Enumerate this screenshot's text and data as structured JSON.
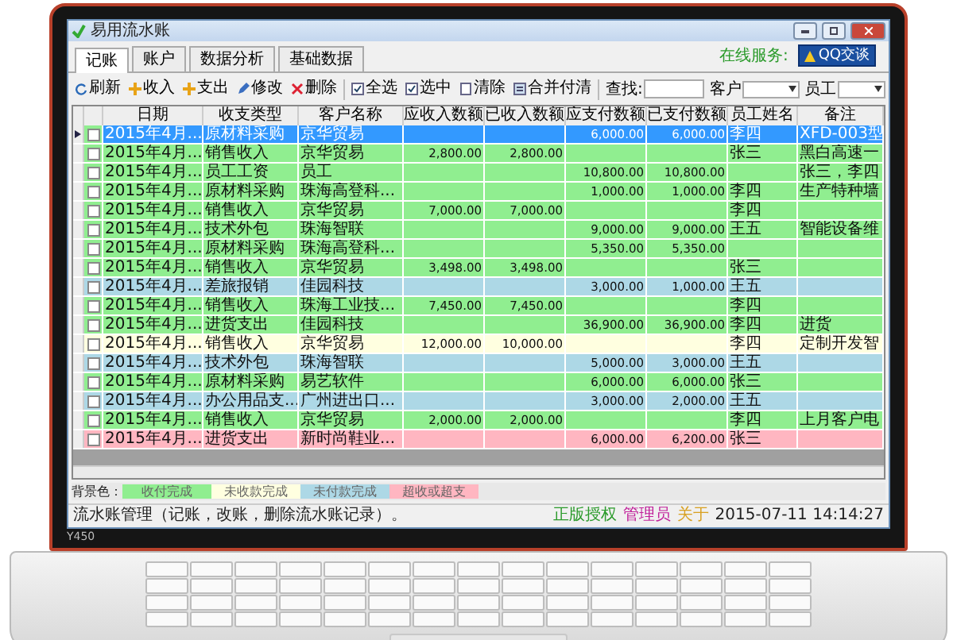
{
  "window": {
    "title": "易用流水账"
  },
  "tabs": [
    {
      "label": "记账",
      "selected": true
    },
    {
      "label": "账户",
      "selected": false
    },
    {
      "label": "数据分析",
      "selected": false
    },
    {
      "label": "基础数据",
      "selected": false
    }
  ],
  "online_service": {
    "label": "在线服务:",
    "button": "QQ交谈"
  },
  "toolbar": {
    "buttons": [
      {
        "kind": "refresh",
        "label": "刷新"
      },
      {
        "kind": "add",
        "label": "收入"
      },
      {
        "kind": "add",
        "label": "支出"
      },
      {
        "kind": "edit",
        "label": "修改"
      },
      {
        "kind": "delete",
        "label": "删除"
      },
      {
        "kind": "check",
        "label": "全选"
      },
      {
        "kind": "check",
        "label": "选中"
      },
      {
        "kind": "clear",
        "label": "清除"
      },
      {
        "kind": "merge",
        "label": "合并付清"
      }
    ],
    "search_label": "查找:",
    "customer_label": "客户",
    "employee_label": "员工"
  },
  "table": {
    "columns": [
      "日期",
      "收支类型",
      "客户名称",
      "应收入数额",
      "已收入数额",
      "应支付数额",
      "已支付数额",
      "员工姓名",
      "备注"
    ],
    "rows": [
      {
        "selected": true,
        "color": "#90ee90",
        "cells": [
          "2015年4月...",
          "原材料采购",
          "京华贸易",
          "",
          "",
          "6,000.00",
          "6,000.00",
          "李四",
          "XFD-003型"
        ]
      },
      {
        "selected": false,
        "color": "#90ee90",
        "cells": [
          "2015年4月...",
          "销售收入",
          "京华贸易",
          "2,800.00",
          "2,800.00",
          "",
          "",
          "张三",
          "黑白高速一"
        ]
      },
      {
        "selected": false,
        "color": "#90ee90",
        "cells": [
          "2015年4月...",
          "员工工资",
          "员工",
          "",
          "",
          "10,800.00",
          "10,800.00",
          "",
          "张三，李四"
        ]
      },
      {
        "selected": false,
        "color": "#90ee90",
        "cells": [
          "2015年4月...",
          "原材料采购",
          "珠海高登科...",
          "",
          "",
          "1,000.00",
          "1,000.00",
          "李四",
          "生产特种墙"
        ]
      },
      {
        "selected": false,
        "color": "#90ee90",
        "cells": [
          "2015年4月...",
          "销售收入",
          "京华贸易",
          "7,000.00",
          "7,000.00",
          "",
          "",
          "李四",
          ""
        ]
      },
      {
        "selected": false,
        "color": "#90ee90",
        "cells": [
          "2015年4月...",
          "技术外包",
          "珠海智联",
          "",
          "",
          "9,000.00",
          "9,000.00",
          "王五",
          "智能设备维"
        ]
      },
      {
        "selected": false,
        "color": "#90ee90",
        "cells": [
          "2015年4月...",
          "原材料采购",
          "珠海高登科...",
          "",
          "",
          "5,350.00",
          "5,350.00",
          "",
          ""
        ]
      },
      {
        "selected": false,
        "color": "#90ee90",
        "cells": [
          "2015年4月...",
          "销售收入",
          "京华贸易",
          "3,498.00",
          "3,498.00",
          "",
          "",
          "张三",
          ""
        ]
      },
      {
        "selected": false,
        "color": "#add8e6",
        "cells": [
          "2015年4月...",
          "差旅报销",
          "佳园科技",
          "",
          "",
          "3,000.00",
          "1,000.00",
          "王五",
          ""
        ]
      },
      {
        "selected": false,
        "color": "#90ee90",
        "cells": [
          "2015年4月...",
          "销售收入",
          "珠海工业技...",
          "7,450.00",
          "7,450.00",
          "",
          "",
          "李四",
          ""
        ]
      },
      {
        "selected": false,
        "color": "#90ee90",
        "cells": [
          "2015年4月...",
          "进货支出",
          "佳园科技",
          "",
          "",
          "36,900.00",
          "36,900.00",
          "李四",
          "进货"
        ]
      },
      {
        "selected": false,
        "color": "#ffffe0",
        "cells": [
          "2015年4月...",
          "销售收入",
          "京华贸易",
          "12,000.00",
          "10,000.00",
          "",
          "",
          "李四",
          "定制开发智"
        ]
      },
      {
        "selected": false,
        "color": "#add8e6",
        "cells": [
          "2015年4月...",
          "技术外包",
          "珠海智联",
          "",
          "",
          "5,000.00",
          "3,000.00",
          "王五",
          ""
        ]
      },
      {
        "selected": false,
        "color": "#90ee90",
        "cells": [
          "2015年4月...",
          "原材料采购",
          "易艺软件",
          "",
          "",
          "6,000.00",
          "6,000.00",
          "张三",
          ""
        ]
      },
      {
        "selected": false,
        "color": "#add8e6",
        "cells": [
          "2015年4月...",
          "办公用品支...",
          "广州进出口...",
          "",
          "",
          "3,000.00",
          "2,000.00",
          "王五",
          ""
        ]
      },
      {
        "selected": false,
        "color": "#90ee90",
        "cells": [
          "2015年4月...",
          "销售收入",
          "京华贸易",
          "2,000.00",
          "2,000.00",
          "",
          "",
          "李四",
          "上月客户电"
        ]
      },
      {
        "selected": false,
        "color": "#ffb6c1",
        "cells": [
          "2015年4月...",
          "进货支出",
          "新时尚鞋业...",
          "",
          "",
          "6,000.00",
          "6,200.00",
          "张三",
          ""
        ]
      }
    ]
  },
  "legend": {
    "label": "背景色：",
    "items": [
      {
        "label": "收付完成",
        "color": "#90ee90"
      },
      {
        "label": "未收款完成",
        "color": "#ffffe0"
      },
      {
        "label": "未付款完成",
        "color": "#add8e6"
      },
      {
        "label": "超收或超支",
        "color": "#ffb6c1"
      }
    ]
  },
  "status_bar": {
    "message": "流水账管理（记账，改账，删除流水账记录）。",
    "license": "正版授权",
    "user": "管理员",
    "about": "关于",
    "datetime": "2015-07-11 14:14:27"
  },
  "laptop": {
    "model": "Y450"
  }
}
